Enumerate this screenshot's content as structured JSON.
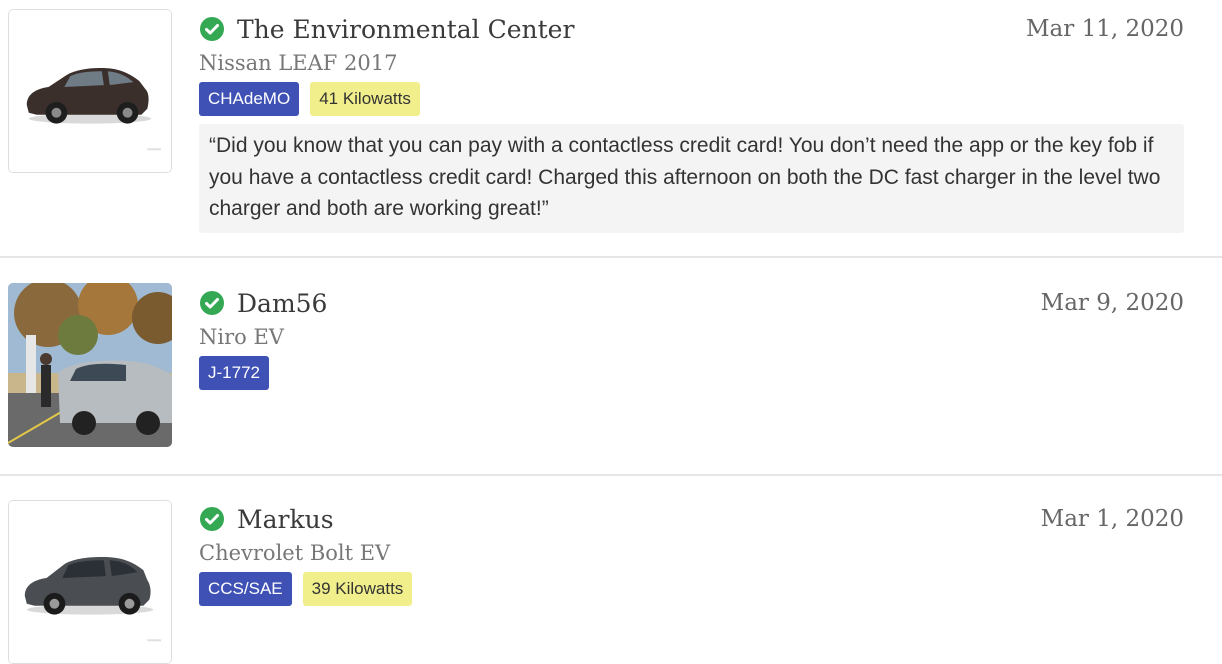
{
  "checkins": [
    {
      "name": "The Environmental Center",
      "date": "Mar 11, 2020",
      "vehicle": "Nissan LEAF 2017",
      "plug": "CHAdeMO",
      "power": "41 Kilowatts",
      "review": "“Did you know that you can pay with a contactless credit card! You don’t need the app or the key fob if you have a contactless credit card! Charged this afternoon on both the DC fast charger in the level two charger and both are working great!”",
      "thumb_icon": "car-photo-icon",
      "verified_icon": "check-circle-icon"
    },
    {
      "name": "Dam56",
      "date": "Mar 9, 2020",
      "vehicle": "Niro EV",
      "plug": "J-1772",
      "thumb_icon": "user-photo",
      "verified_icon": "check-circle-icon"
    },
    {
      "name": "Markus",
      "date": "Mar 1, 2020",
      "vehicle": "Chevrolet Bolt EV",
      "plug": "CCS/SAE",
      "power": "39 Kilowatts",
      "thumb_icon": "car-photo-icon",
      "verified_icon": "check-circle-icon"
    }
  ],
  "colors": {
    "verified_green": "#34a853",
    "plug_badge_bg": "#3f51b5",
    "power_badge_bg": "#f0ef8c",
    "review_bg": "#f4f4f4"
  }
}
